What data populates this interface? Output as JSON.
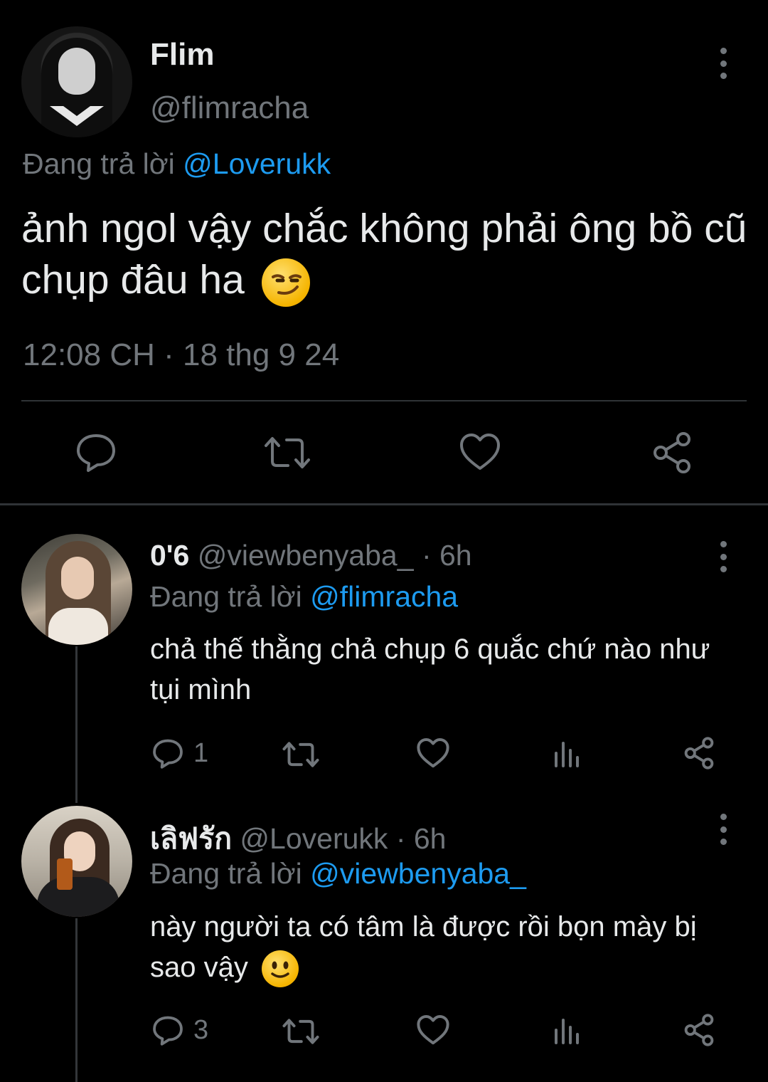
{
  "main_tweet": {
    "display_name": "Flim",
    "handle": "@flimracha",
    "replying_prefix": "Đang trả lời",
    "replying_to": "@Loverukk",
    "text": "ảnh ngol vậy chắc không phải ông bồ cũ chụp đâu ha",
    "emoji": "smirk-emoji",
    "timestamp": "12:08 CH · 18 thg 9 24",
    "actions": [
      "reply-icon",
      "retweet-icon",
      "like-icon",
      "share-icon"
    ]
  },
  "replies": [
    {
      "display_name": "0'6",
      "handle": "@viewbenyaba_",
      "time": "· 6h",
      "replying_prefix": "Đang trả lời",
      "replying_to": "@flimracha",
      "text": "chả thế thằng chả chụp 6 quắc chứ nào như tụi mình",
      "reply_count": "1"
    },
    {
      "display_name": "เลิฟรัก",
      "handle": "@Loverukk",
      "time": "· 6h",
      "replying_prefix": "Đang trả lời",
      "replying_to": "@viewbenyaba_",
      "text": "này người ta có tâm là được rồi bọn mày bị sao vậy",
      "emoji": "slight-smile-emoji",
      "reply_count": "3"
    }
  ],
  "colors": {
    "background": "#000000",
    "text_primary": "#e7e9ea",
    "text_secondary": "#71767b",
    "accent": "#1d9bf0",
    "divider": "#2f3336"
  }
}
